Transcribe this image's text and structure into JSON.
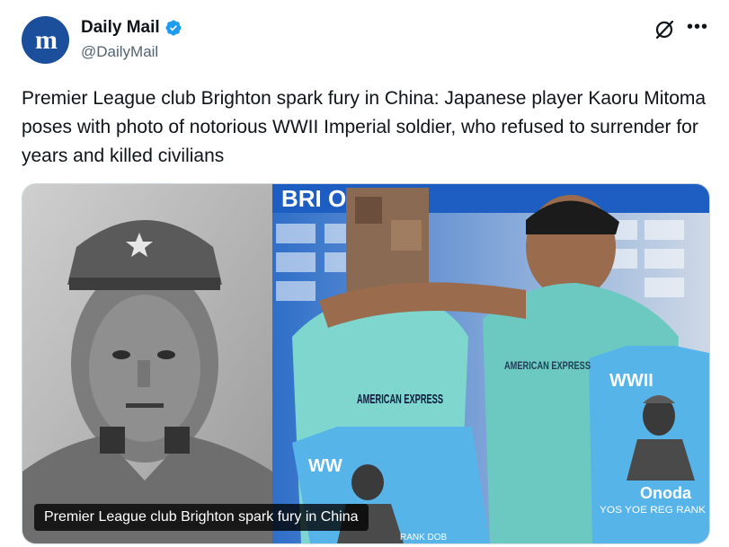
{
  "account": {
    "display_name": "Daily Mail",
    "handle": "@DailyMail",
    "avatar_letter": "m",
    "verified": true
  },
  "tweet": {
    "text": "Premier League club Brighton spark fury in China: Japanese player Kaoru Mitoma poses with photo of notorious WWII Imperial soldier, who refused to surrender for years and killed civilians"
  },
  "media": {
    "caption": "Premier League club Brighton spark fury in China",
    "shirt_sponsor": "AMERICAN EXPRESS",
    "card_top_left": "WW",
    "card_top_right": "WWII",
    "card_name": "Onoda",
    "card_stats": "YOS YOE REG RANK",
    "card_stats_left": "RANK DOB",
    "backdrop_letters": "BRI  ON  H",
    "board_text": "AMERICAN EXPRESS"
  },
  "icons": {
    "grok": "grok-icon",
    "more": "more-options-icon",
    "verified": "verified-badge-icon"
  },
  "colors": {
    "brand_blue": "#1b4f9c",
    "verified_blue": "#1d9bf0",
    "kit_teal": "#7fd6cf",
    "card_blue": "#56b4e9"
  }
}
